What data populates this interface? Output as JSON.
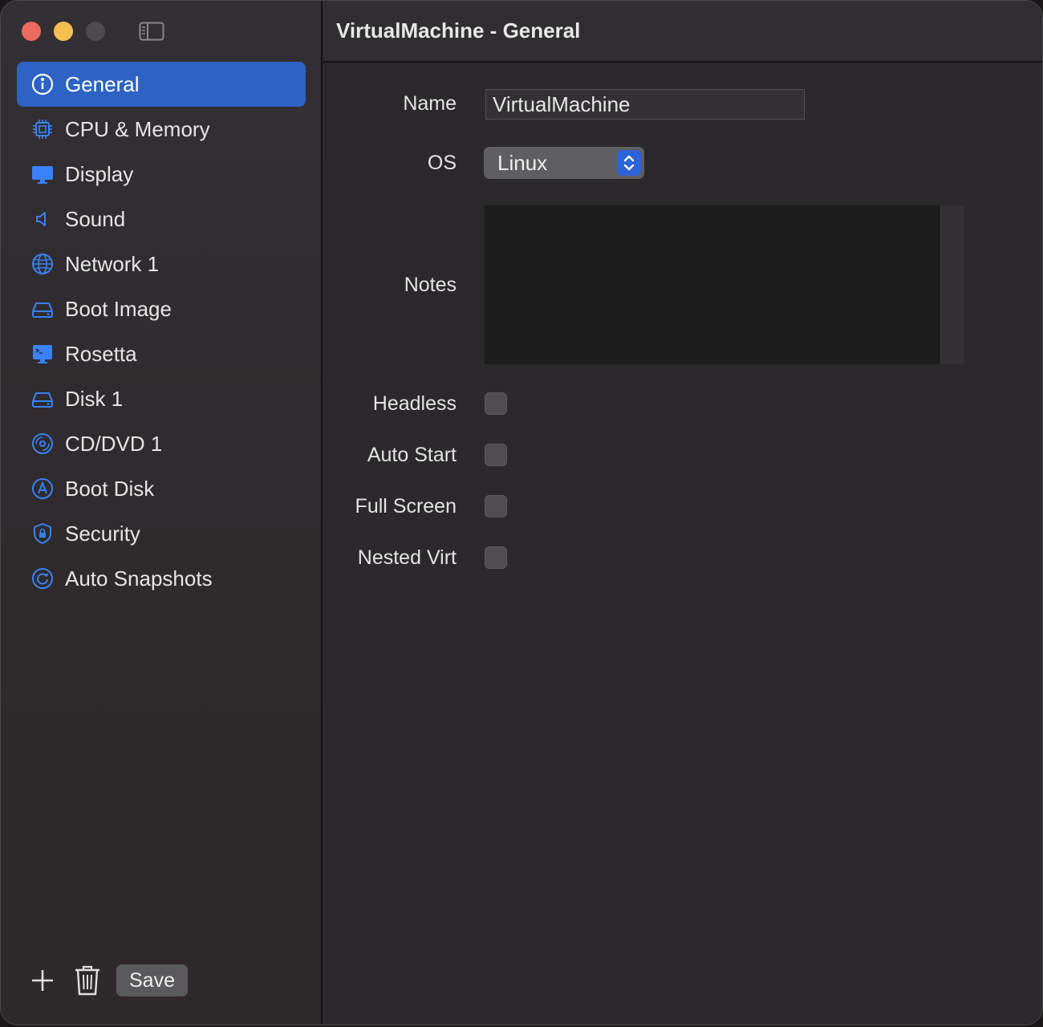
{
  "window": {
    "title": "VirtualMachine - General"
  },
  "sidebar": {
    "items": [
      {
        "label": "General",
        "icon": "info-circle-icon",
        "selected": true
      },
      {
        "label": "CPU & Memory",
        "icon": "cpu-chip-icon"
      },
      {
        "label": "Display",
        "icon": "display-icon"
      },
      {
        "label": "Sound",
        "icon": "speaker-icon"
      },
      {
        "label": "Network 1",
        "icon": "globe-icon"
      },
      {
        "label": "Boot Image",
        "icon": "drive-icon"
      },
      {
        "label": "Rosetta",
        "icon": "terminal-display-icon"
      },
      {
        "label": "Disk 1",
        "icon": "drive-icon"
      },
      {
        "label": "CD/DVD 1",
        "icon": "disc-icon"
      },
      {
        "label": "Boot Disk",
        "icon": "boot-disk-icon"
      },
      {
        "label": "Security",
        "icon": "shield-lock-icon"
      },
      {
        "label": "Auto Snapshots",
        "icon": "snapshot-clock-icon"
      }
    ],
    "save_label": "Save"
  },
  "form": {
    "name_label": "Name",
    "name_value": "VirtualMachine",
    "os_label": "OS",
    "os_value": "Linux",
    "notes_label": "Notes",
    "notes_value": "",
    "headless_label": "Headless",
    "headless_checked": false,
    "auto_start_label": "Auto Start",
    "auto_start_checked": false,
    "full_screen_label": "Full Screen",
    "full_screen_checked": false,
    "nested_virt_label": "Nested Virt",
    "nested_virt_checked": false
  },
  "colors": {
    "accent": "#2c63c4",
    "icon_blue": "#3a82f7",
    "close": "#ed6a5e",
    "minimize": "#f5bf4f"
  }
}
